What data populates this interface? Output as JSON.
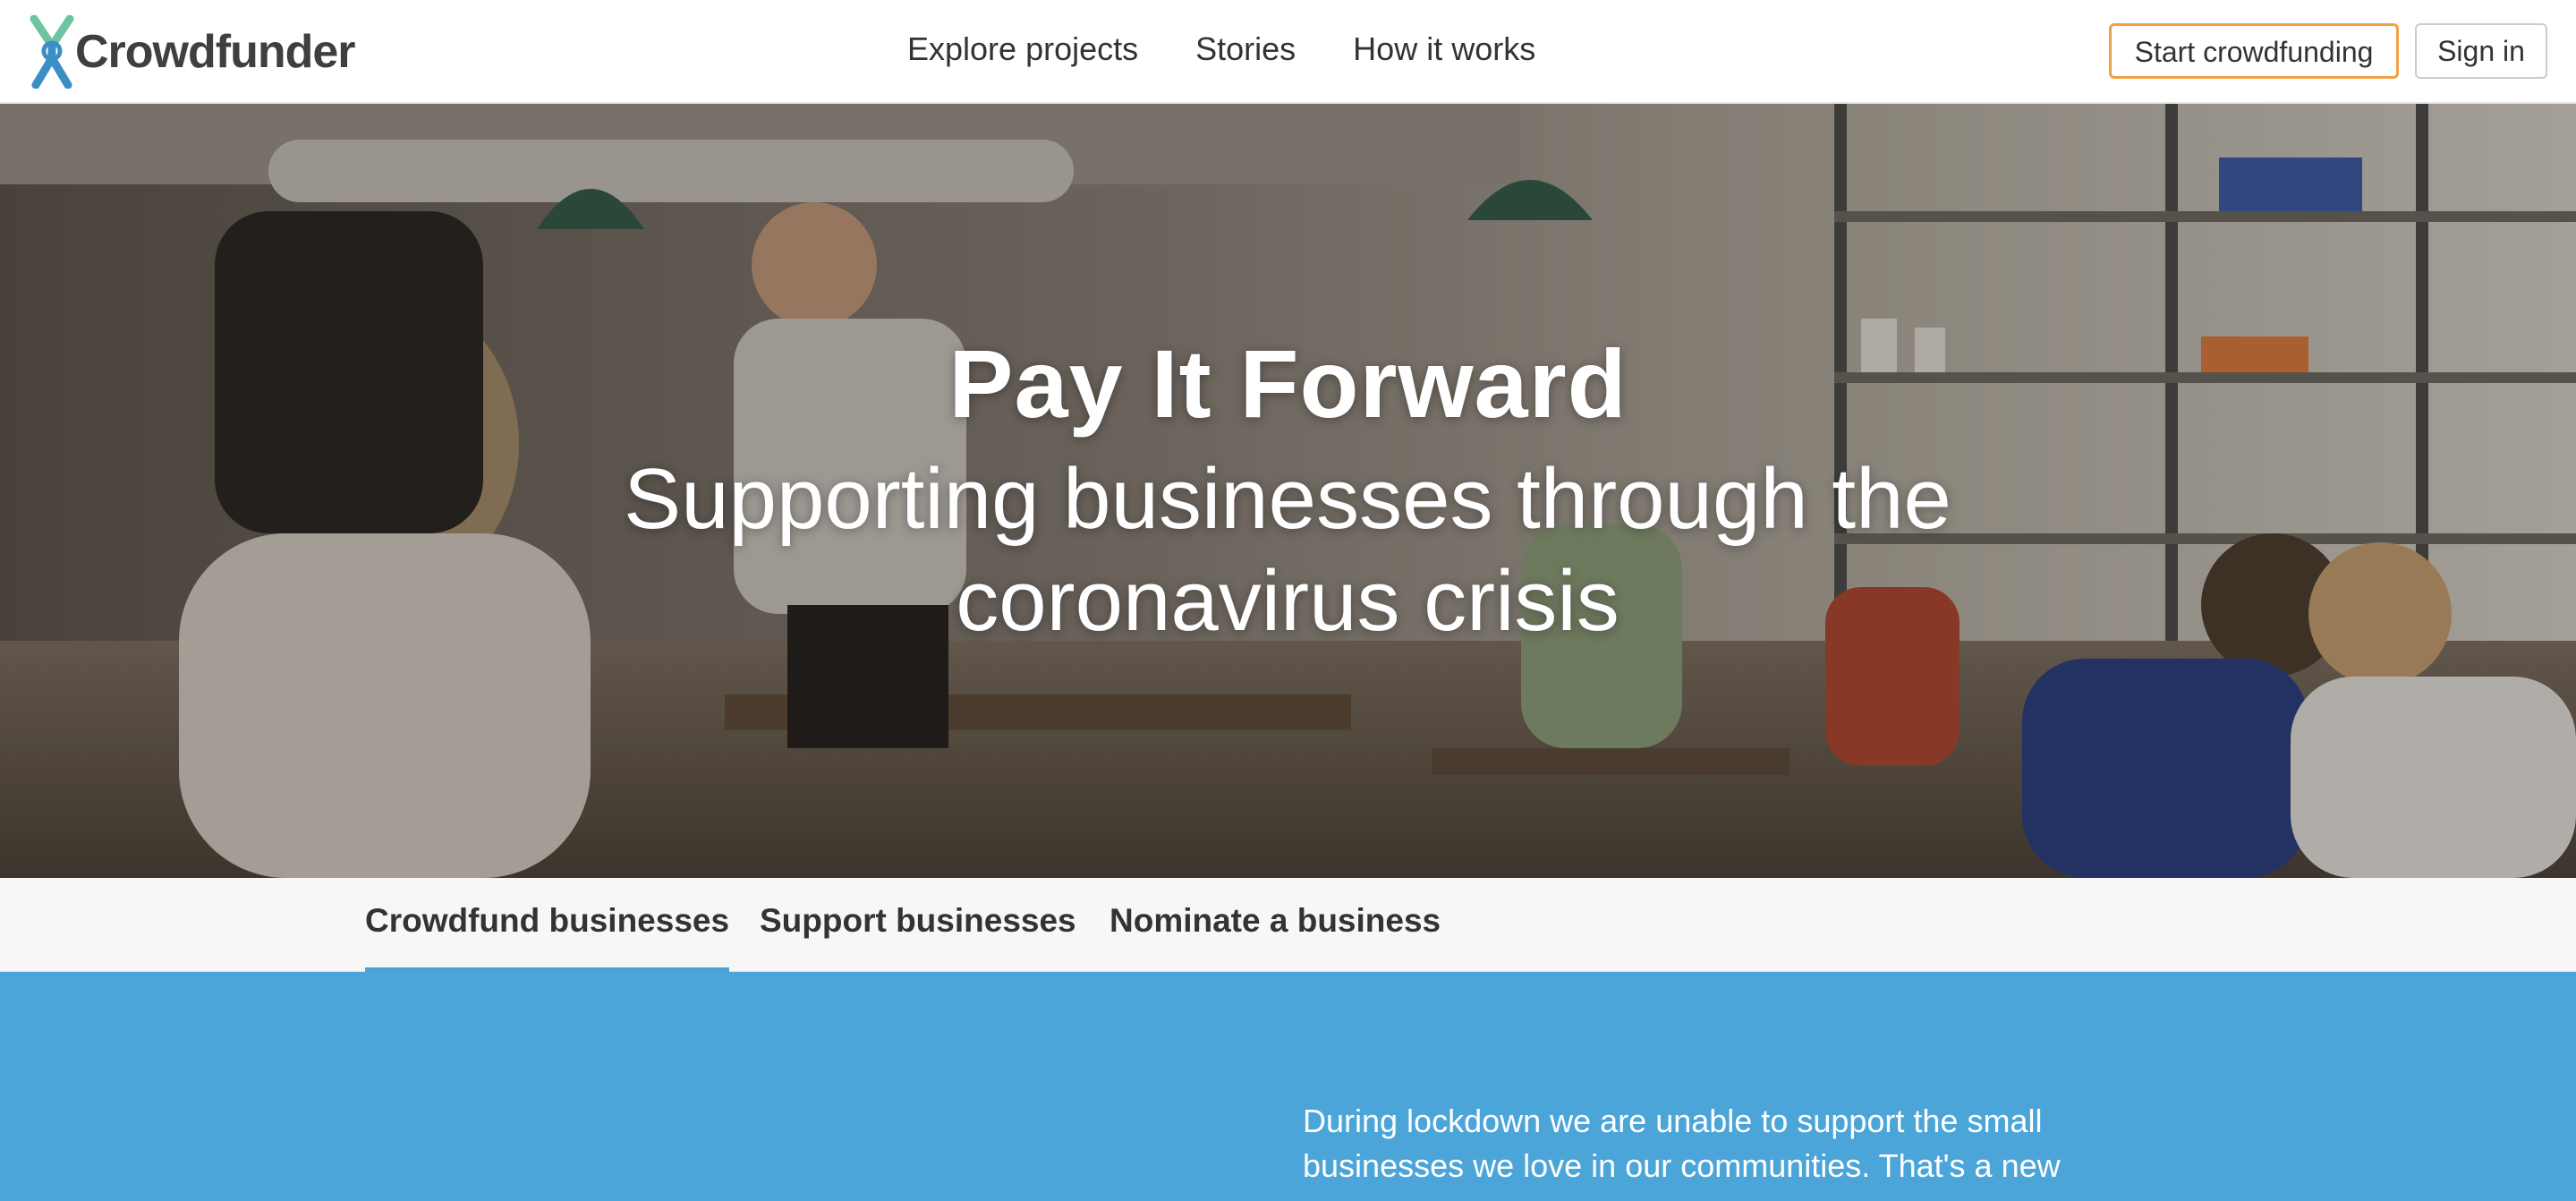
{
  "header": {
    "logo_text": "Crowdfunder",
    "nav": [
      {
        "label": "Explore projects"
      },
      {
        "label": "Stories"
      },
      {
        "label": "How it works"
      }
    ],
    "start_button": "Start crowdfunding",
    "signin_button": "Sign in"
  },
  "hero": {
    "title": "Pay It Forward",
    "subtitle": "Supporting businesses through the coronavirus crisis"
  },
  "tabs": [
    {
      "label": "Crowdfund businesses",
      "active": true
    },
    {
      "label": "Support businesses",
      "active": false
    },
    {
      "label": "Nominate a business",
      "active": false
    }
  ],
  "info": {
    "text": "During lockdown we are unable to support the small businesses we love in our communities. That's a new"
  },
  "colors": {
    "accent_orange": "#f0a045",
    "tab_underline": "#4aa3d8",
    "info_background": "#4ca5d8",
    "logo_green": "#6cc4a1",
    "logo_blue": "#3b8ec4"
  }
}
